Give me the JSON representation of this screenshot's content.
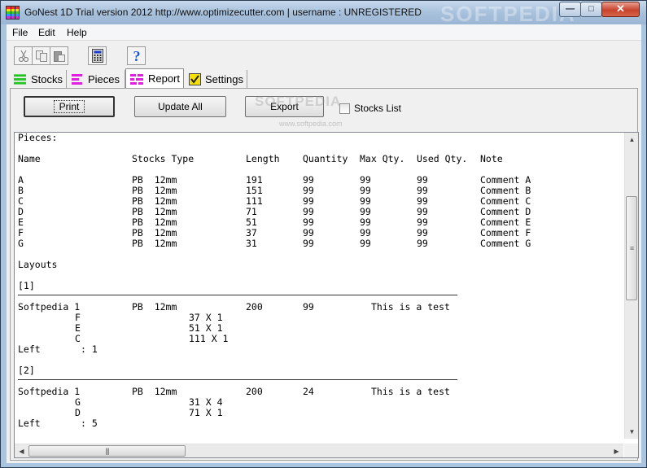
{
  "window": {
    "title": "GoNest 1D Trial version  2012  http://www.optimizecutter.com | username : UNREGISTERED",
    "watermark": "SOFTPEDIA"
  },
  "menu": [
    "File",
    "Edit",
    "Help"
  ],
  "toolbar": {
    "icons": [
      "cut-icon",
      "copy-icon",
      "paste-icon",
      "calculator-icon",
      "help-icon"
    ]
  },
  "tabs": [
    {
      "label": "Stocks",
      "icon": "stocks-icon",
      "color": "#22c522"
    },
    {
      "label": "Pieces",
      "icon": "pieces-icon",
      "color": "#e020e0"
    },
    {
      "label": "Report",
      "icon": "report-icon",
      "color": "#e020e0",
      "active": true
    },
    {
      "label": "Settings",
      "icon": "settings-icon",
      "color": "#e0d000"
    }
  ],
  "actions": {
    "print": "Print",
    "update_all": "Update All",
    "export": "Export",
    "stocks_list": "Stocks List"
  },
  "overlay": {
    "watermark": "SOFTPEDIA",
    "watermark_url": "www.softpedia.com"
  },
  "report": {
    "pieces_heading": "Pieces:",
    "columns": [
      "Name",
      "Stocks Type",
      "Length",
      "Quantity",
      "Max Qty.",
      "Used Qty.",
      "Note"
    ],
    "pieces": [
      {
        "name": "A",
        "type": "PB  12mm",
        "length": "191",
        "quantity": "99",
        "max_qty": "99",
        "used_qty": "99",
        "note": "Comment A"
      },
      {
        "name": "B",
        "type": "PB  12mm",
        "length": "151",
        "quantity": "99",
        "max_qty": "99",
        "used_qty": "99",
        "note": "Comment B"
      },
      {
        "name": "C",
        "type": "PB  12mm",
        "length": "111",
        "quantity": "99",
        "max_qty": "99",
        "used_qty": "99",
        "note": "Comment C"
      },
      {
        "name": "D",
        "type": "PB  12mm",
        "length": "71",
        "quantity": "99",
        "max_qty": "99",
        "used_qty": "99",
        "note": "Comment D"
      },
      {
        "name": "E",
        "type": "PB  12mm",
        "length": "51",
        "quantity": "99",
        "max_qty": "99",
        "used_qty": "99",
        "note": "Comment E"
      },
      {
        "name": "F",
        "type": "PB  12mm",
        "length": "37",
        "quantity": "99",
        "max_qty": "99",
        "used_qty": "99",
        "note": "Comment F"
      },
      {
        "name": "G",
        "type": "PB  12mm",
        "length": "31",
        "quantity": "99",
        "max_qty": "99",
        "used_qty": "99",
        "note": "Comment G"
      }
    ],
    "layouts_heading": "Layouts",
    "layouts": [
      {
        "index": "[1]",
        "stock": "Softpedia 1",
        "type": "PB  12mm",
        "length": "200",
        "count": "99",
        "comment": "This is a test",
        "parts": [
          {
            "piece": "F",
            "cut": "37 X 1"
          },
          {
            "piece": "E",
            "cut": "51 X 1"
          },
          {
            "piece": "C",
            "cut": "111 X 1"
          }
        ],
        "left_label": "Left",
        "left_value": ": 1"
      },
      {
        "index": "[2]",
        "stock": "Softpedia 1",
        "type": "PB  12mm",
        "length": "200",
        "count": "24",
        "comment": "This is a test",
        "parts": [
          {
            "piece": "G",
            "cut": "31 X 4"
          },
          {
            "piece": "D",
            "cut": "71 X 1"
          }
        ],
        "left_label": "Left",
        "left_value": ": 5"
      }
    ]
  }
}
